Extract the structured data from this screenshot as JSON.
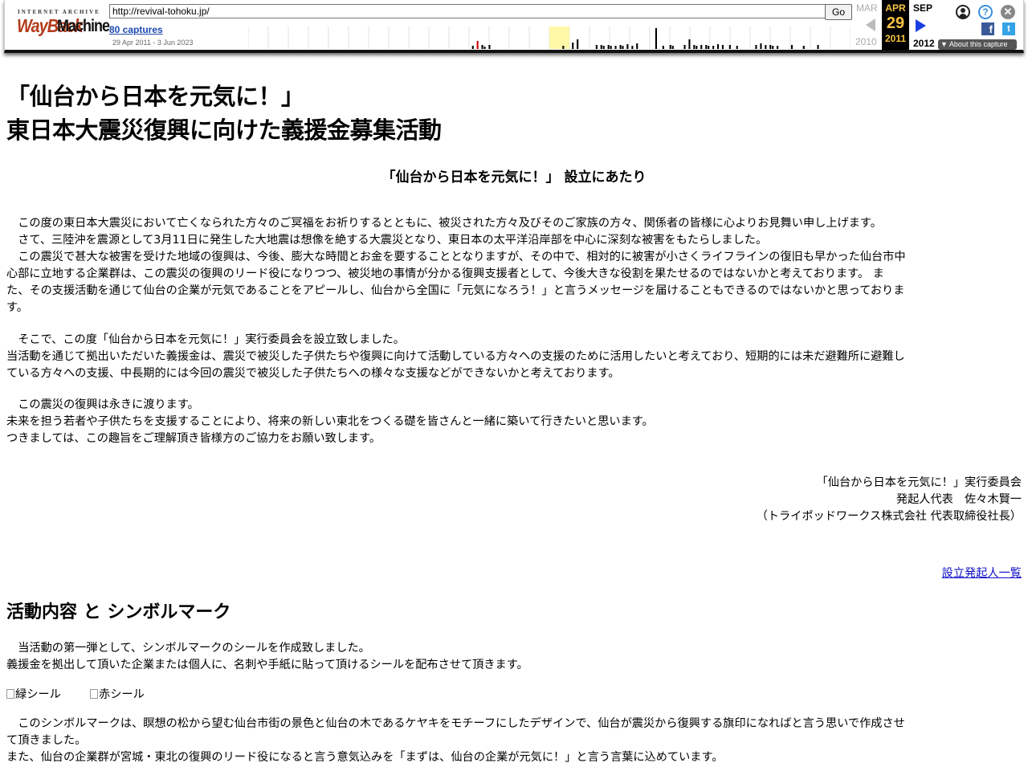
{
  "wayback": {
    "logo_top": "INTERNET ARCHIVE",
    "logo_wayback": "WayBack",
    "logo_machine": "Machine",
    "url": "http://revival-tohoku.jp/",
    "go_label": "Go",
    "captures": "80 captures",
    "range": "29 Apr 2011 - 3 Jun 2023",
    "prev_month": "MAR",
    "prev_year": "2010",
    "cur_month": "APR",
    "cur_day": "29",
    "cur_year": "2011",
    "next_month": "SEP",
    "next_year": "2012",
    "about": "About this capture",
    "spark_heights": [
      0,
      0,
      0,
      0,
      0,
      0,
      0,
      0,
      0,
      0,
      0,
      0,
      0,
      0,
      0,
      0,
      0,
      0,
      0,
      0,
      0,
      0,
      0,
      0,
      0,
      0,
      0,
      0,
      0,
      0,
      0,
      0,
      0,
      0,
      0,
      0,
      0,
      0,
      0,
      0,
      0,
      0,
      0,
      0,
      0,
      0,
      0,
      0,
      0,
      0,
      0,
      0,
      0,
      0,
      0,
      0,
      0,
      0,
      0,
      0,
      0,
      0,
      0,
      0,
      0,
      0,
      0,
      0,
      0,
      0,
      0,
      0,
      0,
      0,
      0,
      0,
      0,
      0,
      0,
      0,
      0,
      0,
      0,
      0,
      0,
      0,
      0,
      0,
      0,
      0,
      0,
      0,
      0,
      0,
      4,
      0,
      10,
      0,
      5,
      3,
      0,
      5,
      0,
      0,
      0,
      0,
      0,
      0,
      0,
      0,
      0,
      0,
      0,
      0,
      0,
      0,
      0,
      0,
      0,
      0,
      0,
      0,
      0,
      0,
      0,
      0,
      0,
      0,
      0,
      0,
      0,
      0,
      4,
      0,
      0,
      0,
      8,
      0,
      12,
      0,
      0,
      0,
      0,
      0,
      0,
      0,
      5,
      0,
      5,
      4,
      0,
      5,
      4,
      0,
      4,
      0,
      5,
      4,
      0,
      6,
      0,
      4,
      0,
      7,
      0,
      0,
      0,
      0,
      0,
      0,
      0,
      26,
      0,
      0,
      4,
      0,
      0,
      5,
      4,
      0,
      0,
      0,
      0,
      5,
      0,
      12,
      0,
      5,
      4,
      0,
      5,
      0,
      5,
      4,
      0,
      4,
      0,
      6,
      0,
      5,
      0,
      0,
      5,
      0,
      0,
      4,
      0,
      0,
      0,
      0,
      0,
      0,
      0,
      5,
      0,
      7,
      0,
      5,
      0,
      5,
      4,
      0,
      4,
      0,
      0,
      0,
      0,
      0,
      5,
      0,
      0,
      0,
      0,
      4,
      0,
      0,
      0,
      0,
      0,
      5,
      0,
      0,
      0,
      0,
      0,
      0,
      0,
      0,
      0,
      0,
      0,
      0,
      0
    ]
  },
  "page": {
    "title_line1": "「仙台から日本を元気に！」",
    "title_line2": "東日本大震災復興に向けた義援金募集活動",
    "subtitle": "「仙台から日本を元気に！」 設立にあたり",
    "para1": [
      "　この度の東日本大震災において亡くなられた方々のご冥福をお祈りするとともに、被災された方々及びそのご家族の方々、関係者の皆様に心よりお見舞い申し上げます。",
      "　さて、三陸沖を震源として3月11日に発生した大地震は想像を絶する大震災となり、東日本の太平洋沿岸部を中心に深刻な被害をもたらしました。",
      "　この震災で甚大な被害を受けた地域の復興は、今後、膨大な時間とお金を要することとなりますが、その中で、相対的に被害が小さくライフラインの復旧も早かった仙台市中",
      "心部に立地する企業群は、この震災の復興のリード役になりつつ、被災地の事情が分かる復興支援者として、今後大きな役割を果たせるのではないかと考えております。 ま",
      "た、その支援活動を通じて仙台の企業が元気であることをアピールし、仙台から全国に「元気になろう！」と言うメッセージを届けることもできるのではないかと思っておりま",
      "す。"
    ],
    "para2": [
      "　そこで、この度「仙台から日本を元気に！」実行委員会を設立致しました。",
      "当活動を通じて拠出いただいた義援金は、震災で被災した子供たちや復興に向けて活動している方々への支援のために活用したいと考えており、短期的には未だ避難所に避難し",
      "ている方々への支援、中長期的には今回の震災で被災した子供たちへの様々な支援などができないかと考えております。"
    ],
    "para3": [
      "　この震災の復興は永きに渡ります。",
      "未来を担う若者や子供たちを支援することにより、将来の新しい東北をつくる礎を皆さんと一緒に築いて行きたいと思います。",
      "つきましては、この趣旨をご理解頂き皆様方のご協力をお願い致します。"
    ],
    "sign": [
      "「仙台から日本を元気に！」実行委員会",
      "発起人代表　佐々木賢一",
      "（トライポッドワークス株式会社 代表取締役社長）"
    ],
    "founders_link": "設立発起人一覧",
    "section2_title": "活動内容 と シンボルマーク",
    "para4": [
      "　当活動の第一弾として、シンボルマークのシールを作成致しました。",
      "義援金を拠出して頂いた企業または個人に、名刺や手紙に貼って頂けるシールを配布させて頂きます。"
    ],
    "sticker_green": "緑シール",
    "sticker_red": "赤シール",
    "para5": [
      "　このシンボルマークは、瞑想の松から望む仙台市街の景色と仙台の木であるケヤキをモチーフにしたデザインで、仙台が震災から復興する旗印になればと言う思いで作成させ",
      "て頂きました。",
      "また、仙台の企業群が宮城・東北の復興のリード役になると言う意気込みを「まずは、仙台の企業が元気に！」と言う言葉に込めています。"
    ]
  }
}
